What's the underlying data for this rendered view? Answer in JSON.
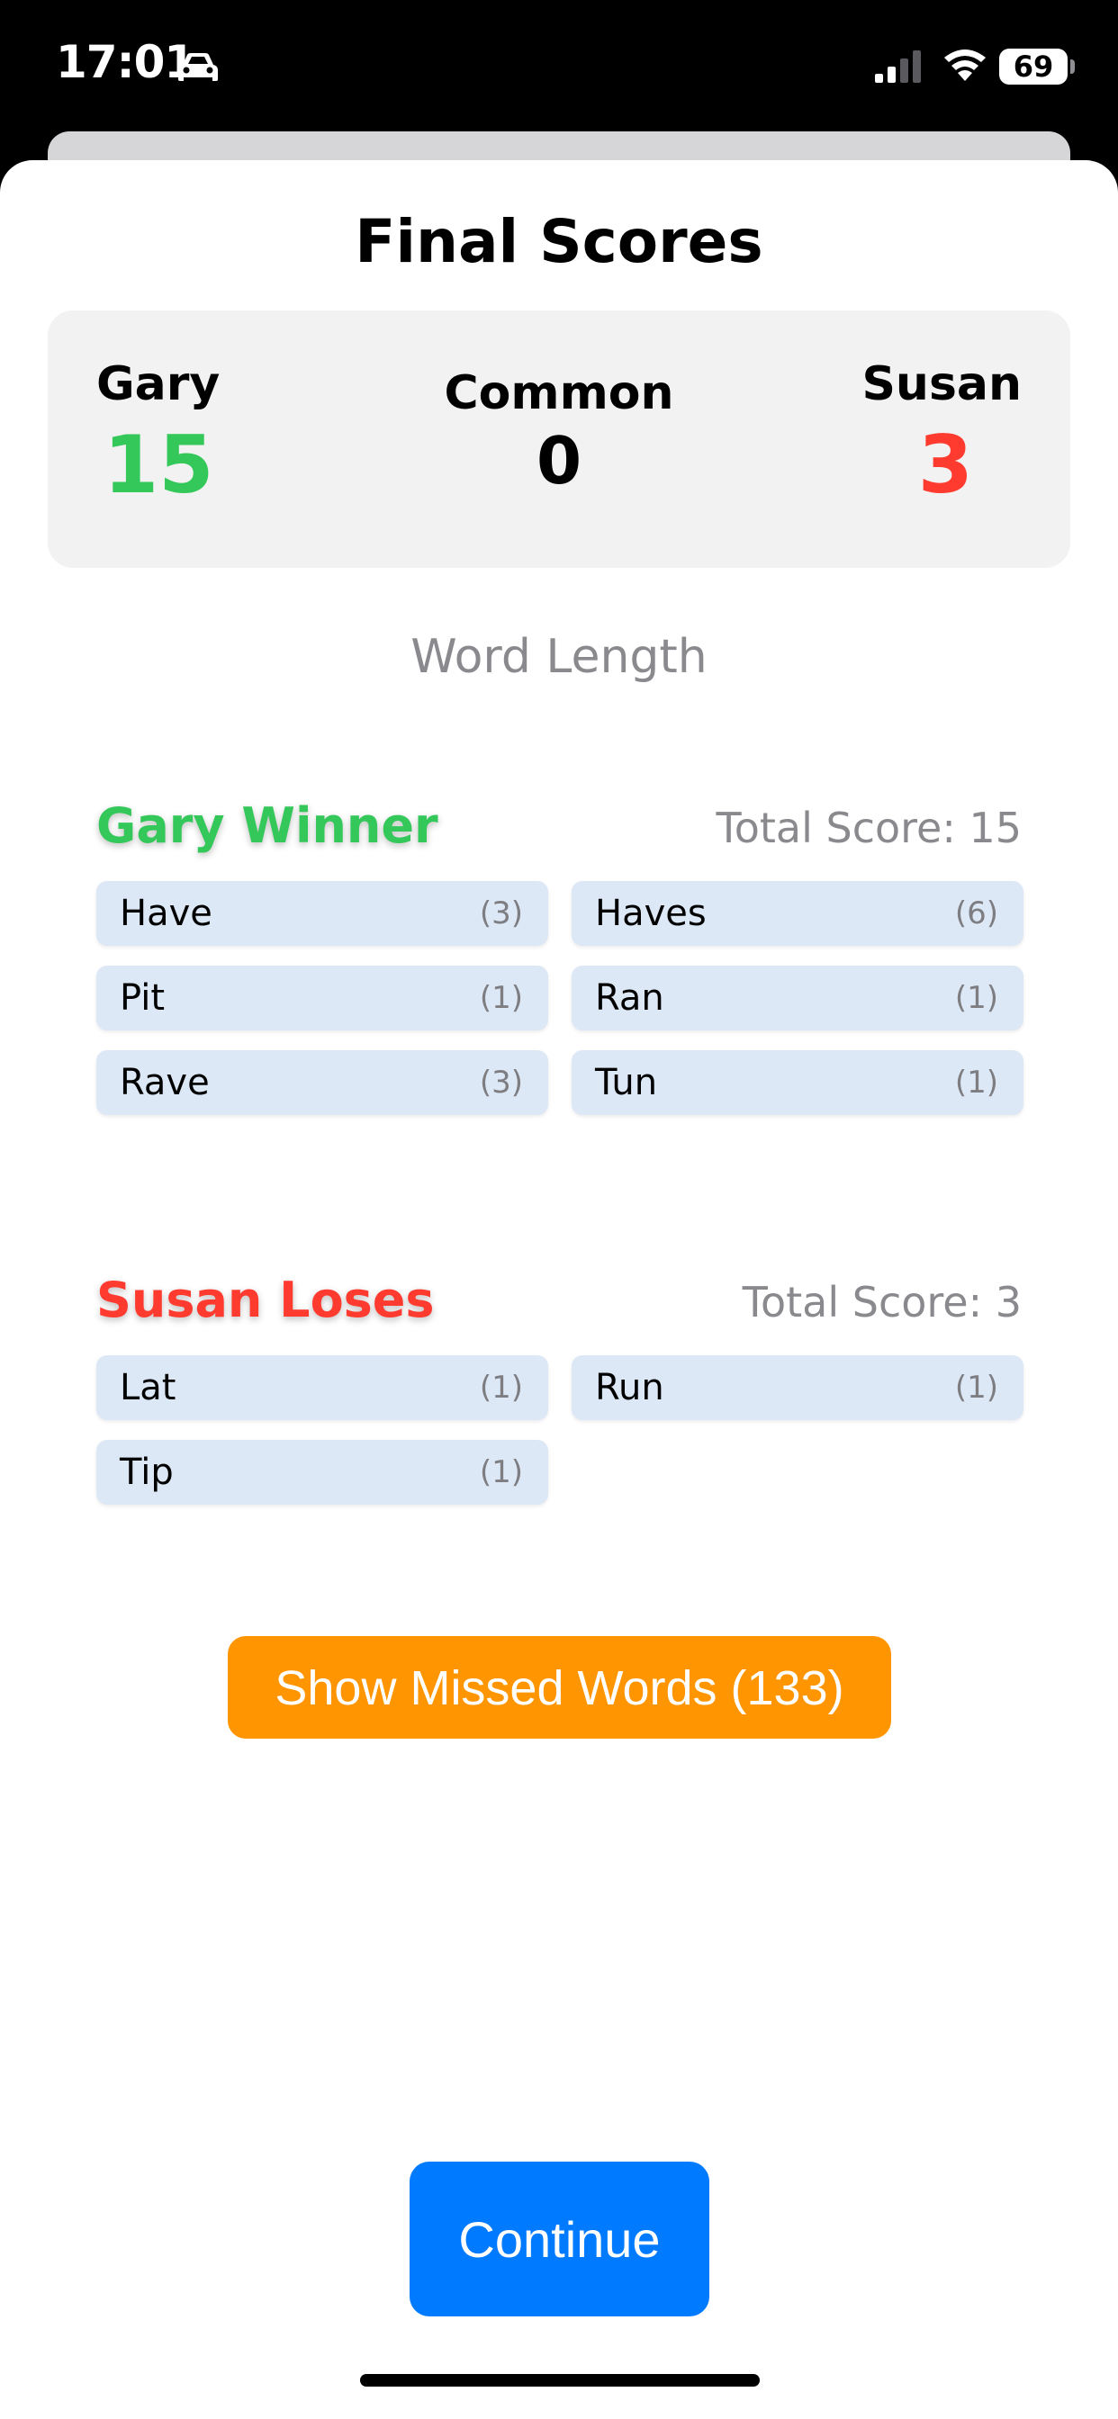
{
  "status_bar": {
    "time": "17:01",
    "battery": "69",
    "icons": [
      "car-icon",
      "signal-icon",
      "wifi-icon",
      "battery-icon"
    ]
  },
  "title": "Final Scores",
  "scores": {
    "player1": {
      "name": "Gary",
      "score": "15",
      "color": "#34c759"
    },
    "common": {
      "name": "Common",
      "score": "0"
    },
    "player2": {
      "name": "Susan",
      "score": "3",
      "color": "#ff3b30"
    }
  },
  "word_length_label": "Word Length",
  "gary_section": {
    "heading": "Gary Winner",
    "total": "Total Score: 15",
    "words": [
      {
        "word": "Have",
        "points": "(3)"
      },
      {
        "word": "Haves",
        "points": "(6)"
      },
      {
        "word": "Pit",
        "points": "(1)"
      },
      {
        "word": "Ran",
        "points": "(1)"
      },
      {
        "word": "Rave",
        "points": "(3)"
      },
      {
        "word": "Tun",
        "points": "(1)"
      }
    ]
  },
  "susan_section": {
    "heading": "Susan Loses",
    "total": "Total Score: 3",
    "words": [
      {
        "word": "Lat",
        "points": "(1)"
      },
      {
        "word": "Run",
        "points": "(1)"
      },
      {
        "word": "Tip",
        "points": "(1)"
      }
    ]
  },
  "buttons": {
    "missed_words": "Show Missed Words (133)",
    "continue": "Continue"
  },
  "colors": {
    "winner": "#34c759",
    "loser": "#ff3b30",
    "missed_button": "#ff9500",
    "continue_button": "#007aff",
    "chip": "#dde8f6"
  }
}
